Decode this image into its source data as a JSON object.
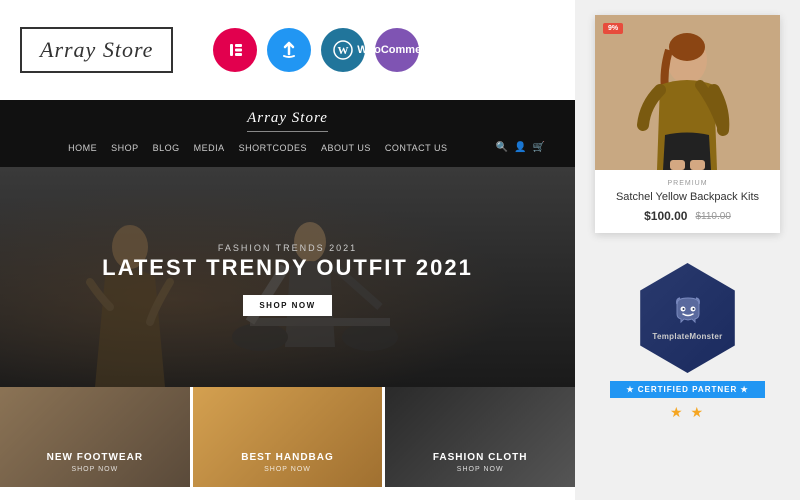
{
  "header": {
    "store_name": "Array Store",
    "nav_logo": "Array Store"
  },
  "tech_icons": [
    {
      "name": "elementor-icon",
      "symbol": "E",
      "class": "icon-elementor",
      "label": "Elementor"
    },
    {
      "name": "updraft-icon",
      "symbol": "↻",
      "class": "icon-updraft",
      "label": "Updraft"
    },
    {
      "name": "wordpress-icon",
      "symbol": "W",
      "class": "icon-wordpress",
      "label": "WordPress"
    },
    {
      "name": "woocommerce-icon",
      "symbol": "Woo",
      "class": "icon-woo",
      "label": "WooCommerce"
    }
  ],
  "nav": {
    "links": [
      "Home",
      "Shop",
      "Blog",
      "Media",
      "Shortcodes",
      "About Us",
      "Contact Us"
    ]
  },
  "hero": {
    "subtitle": "Fashion Trends 2021",
    "title": "LATEST TRENDY OUTFIT 2021",
    "cta_label": "SHOP NOW"
  },
  "categories": [
    {
      "title": "NEW FOOTWEAR",
      "link": "SHOP NOW"
    },
    {
      "title": "BEST HANDBAG",
      "link": "SHOP NOW"
    },
    {
      "title": "FASHION CLOTH",
      "link": "SHOP NOW"
    }
  ],
  "product": {
    "badge": "9%",
    "tag": "PREMIUM",
    "name": "Satchel Yellow Backpack Kits",
    "price_current": "$100.00",
    "price_old": "$110.00"
  },
  "template_monster": {
    "name": "TemplateMon​ster",
    "certified_label": "★ CERTIFIED PARTNER ★",
    "stars": "★ ★"
  }
}
